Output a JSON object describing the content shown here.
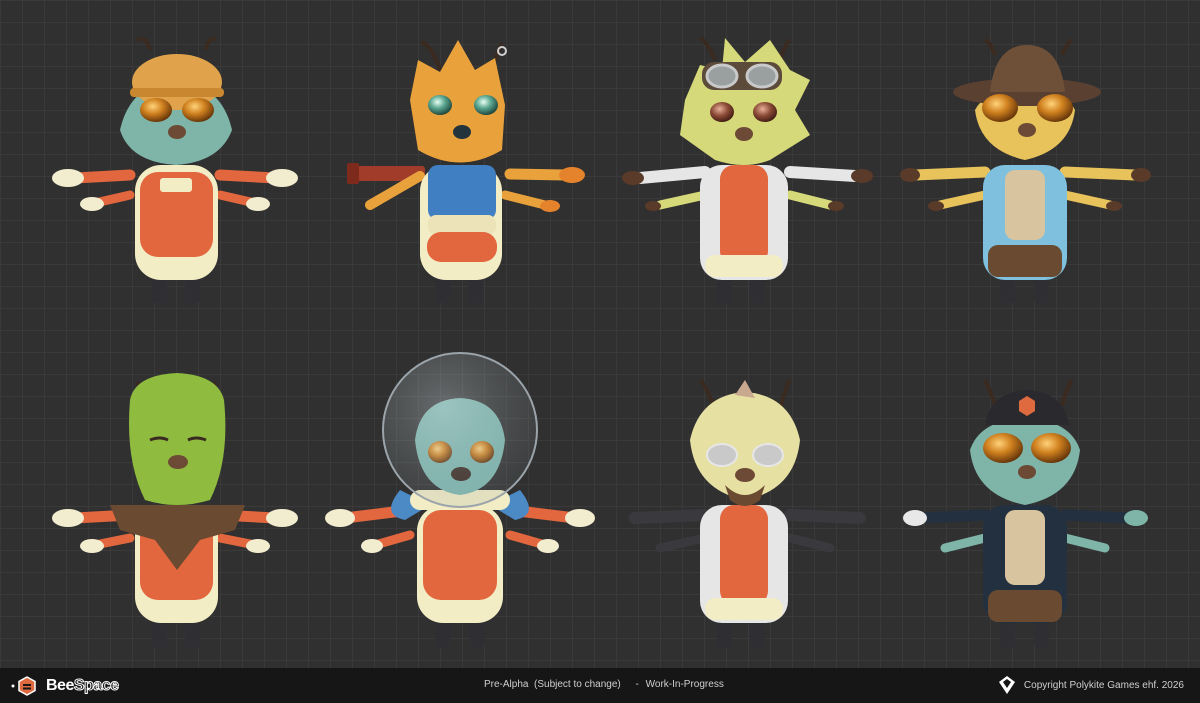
{
  "footer": {
    "brand_word1": "Bee",
    "brand_word2": "Space",
    "status_text": "Pre-Alpha  (Subject to change)",
    "separator": "-",
    "progress_text": "Work-In-Progress",
    "copyright": "Copyright Polykite Games ehf. 2026"
  },
  "colors": {
    "background": "#303030",
    "grid": "#3a3a3a",
    "footer": "#161616",
    "accent_orange": "#e06a40"
  },
  "characters": [
    {
      "id": "hardhat-worker",
      "fur": "#7fb5a8",
      "outfit": "#e2673f",
      "accessory": "hard-hat"
    },
    {
      "id": "spiky-orange",
      "fur": "#e9a23b",
      "outfit": "#3f7fc2",
      "accessory": "pipe"
    },
    {
      "id": "goggles-scientist",
      "fur": "#d6d97a",
      "outfit": "#e2673f",
      "accessory": "goggles"
    },
    {
      "id": "cowboy-hawaiian",
      "fur": "#e8c25a",
      "outfit": "#7ec0dd",
      "accessory": "cowboy-hat"
    },
    {
      "id": "green-scout",
      "fur": "#8fbb3f",
      "outfit": "#e2673f",
      "accessory": "scarf"
    },
    {
      "id": "astronaut",
      "fur": "#7fb8b0",
      "outfit": "#e2673f",
      "accessory": "helmet"
    },
    {
      "id": "elder-scientist",
      "fur": "#e6e1a3",
      "outfit": "#e2673f",
      "accessory": "glasses"
    },
    {
      "id": "cap-pilot",
      "fur": "#7fb5a8",
      "outfit": "#223040",
      "accessory": "cap"
    }
  ]
}
